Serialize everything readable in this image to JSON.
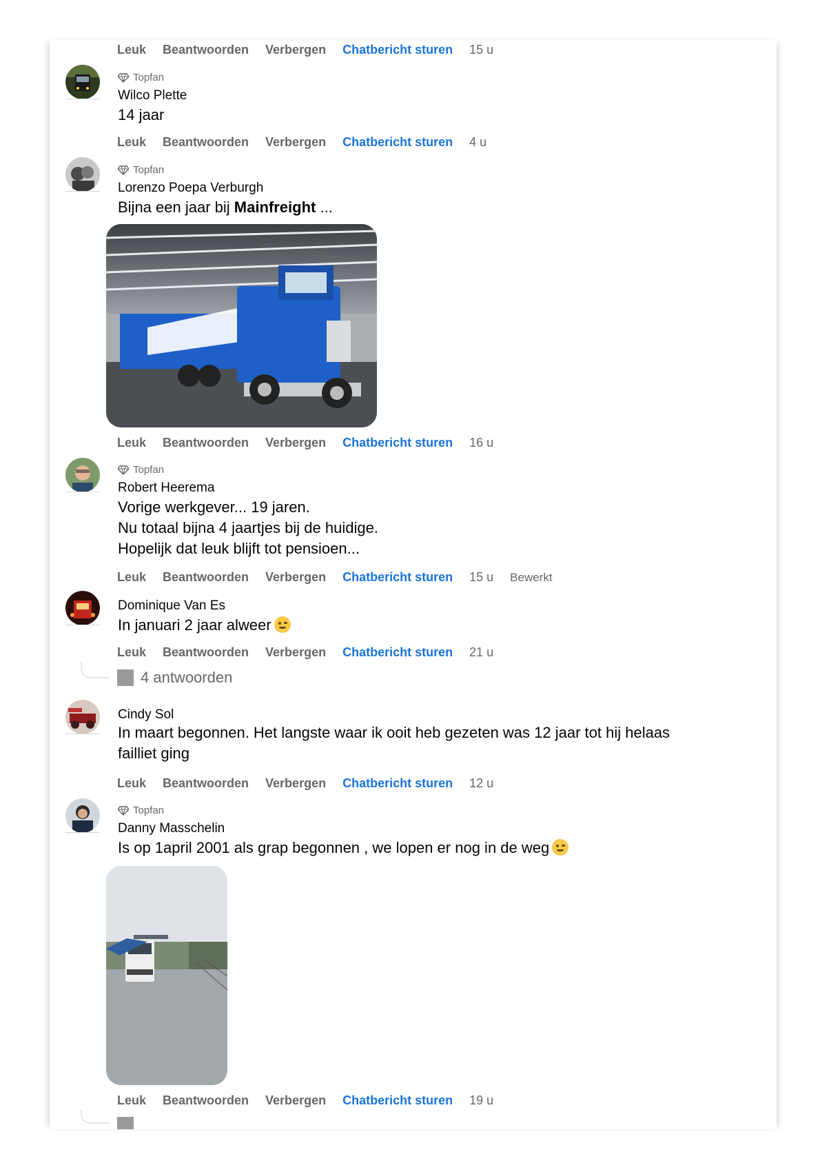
{
  "actions": {
    "like": "Leuk",
    "reply": "Beantwoorden",
    "hide": "Verbergen",
    "chat": "Chatbericht sturen",
    "edited": "Bewerkt"
  },
  "top_row": {
    "time": "15 u"
  },
  "badge_label": "Topfan",
  "comments": [
    {
      "name": "Wilco Plette",
      "lines": [
        "14 jaar"
      ],
      "time": "4 u",
      "topfan": true
    },
    {
      "name": "Lorenzo Poepa Verburgh",
      "text_pre": "Bijna een jaar bij ",
      "text_bold": "Mainfreight",
      "text_post": " ...",
      "time": "16 u",
      "topfan": true
    },
    {
      "name": "Robert Heerema",
      "lines": [
        "Vorige werkgever... 19 jaren.",
        "Nu totaal bijna 4 jaartjes bij de huidige.",
        "Hopelijk dat leuk blijft tot pensioen..."
      ],
      "time": "15 u",
      "topfan": true,
      "edited": true
    },
    {
      "name": "Dominique Van Es",
      "lines": [
        "In januari 2 jaar alweer"
      ],
      "time": "21 u",
      "topfan": false,
      "replies": "4 antwoorden"
    },
    {
      "name": "Cindy Sol",
      "lines": [
        "In maart begonnen. Het langste waar ik ooit heb gezeten was 12 jaar tot hij helaas",
        "failliet ging"
      ],
      "time": "12 u",
      "topfan": false
    },
    {
      "name": "Danny Masschelin",
      "lines": [
        "Is op 1april 2001 als grap begonnen , we lopen er nog in de weg"
      ],
      "time": "19 u",
      "topfan": true
    }
  ],
  "colors": {
    "chat_link": "#1b74d8",
    "meta": "#65676b",
    "text": "#050505",
    "truck_blue": "#1f5fc8"
  }
}
